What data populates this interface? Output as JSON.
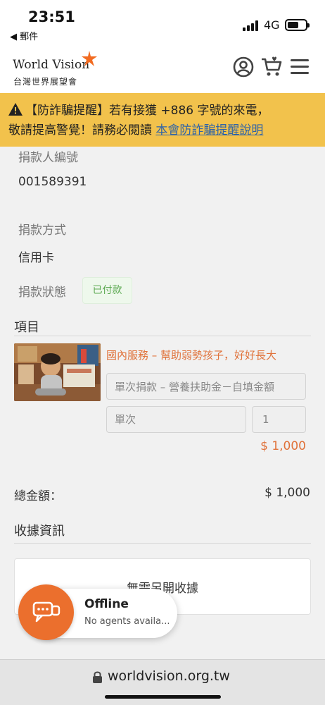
{
  "status_bar": {
    "time": "23:51",
    "back_app": "◀ 郵件",
    "network": "4G"
  },
  "header": {
    "logo_en": "World Vision",
    "logo_zh": "台灣世界展望會",
    "brand_color": "#f26b21",
    "icons": [
      "user-icon",
      "cart-icon",
      "menu-icon"
    ]
  },
  "alert": {
    "line1": "【防詐騙提醒】若有接獲 +886 字號的來電，",
    "line2_prefix": "敬請提高警覺！請務必閱讀 ",
    "link": "本會防詐騙提醒說明",
    "bg_color": "#f2c24c"
  },
  "donor": {
    "id_label": "捐款人編號",
    "id_value": "001589391",
    "method_label": "捐款方式",
    "method_value": "信用卡",
    "status_label": "捐款狀態",
    "status_value": "已付款"
  },
  "items": {
    "section_title": "項目",
    "list": [
      {
        "title": "國內服務 – 幫助弱勢孩子，好好長大",
        "type": "單次捐款 – 營養扶助金－自填金額",
        "frequency": "單次",
        "quantity": "1",
        "amount": "$ 1,000"
      }
    ]
  },
  "total": {
    "label": "總金額：",
    "value": "$ 1,000"
  },
  "receipt": {
    "section_title": "收據資訊",
    "text": "無需另開收據"
  },
  "chat": {
    "title": "Offline",
    "subtitle": "No agents availa...",
    "color": "#eb6f2d"
  },
  "browser": {
    "url": "worldvision.org.tw"
  }
}
